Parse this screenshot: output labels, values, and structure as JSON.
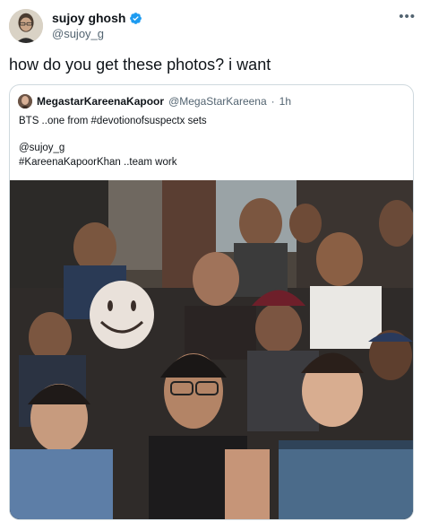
{
  "author": {
    "name": "sujoy ghosh",
    "handle": "@sujoy_g",
    "verified": true
  },
  "tweet": {
    "text": "how do you get these photos? i want"
  },
  "quoted": {
    "name": "MegastarKareenaKapoor",
    "handle": "@MegaStarKareena",
    "time": "1h",
    "lines": [
      "BTS ..one from #devotionofsuspectx sets",
      "@sujoy_g",
      "#KareenaKapoorKhan ..team work"
    ]
  },
  "icons": {
    "verified": "verified-badge-icon",
    "more": "more-options-icon"
  },
  "colors": {
    "verified_blue": "#1d9bf0",
    "secondary_text": "#536471",
    "border": "#cfd9de"
  }
}
